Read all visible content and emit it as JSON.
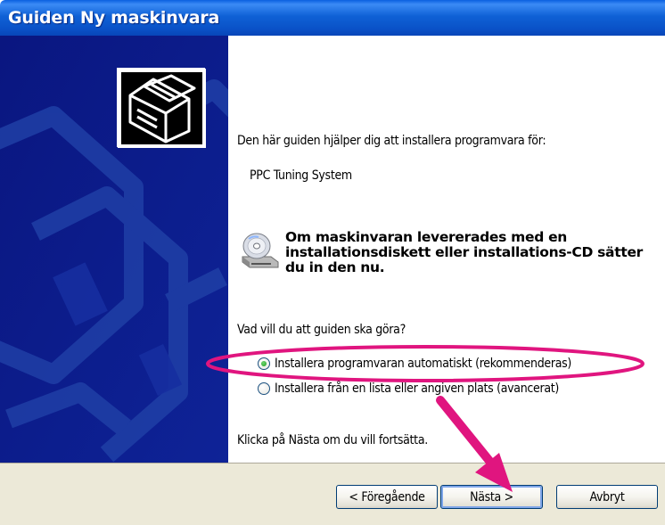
{
  "window": {
    "title": "Guiden Ny maskinvara"
  },
  "content": {
    "intro": "Den här guiden hjälper dig att installera programvara för:",
    "device_name": "PPC Tuning System",
    "cd_message": "Om maskinvaran levererades med en installationsdiskett eller installations-CD sätter du in den nu.",
    "question": "Vad vill du att guiden ska göra?",
    "options": [
      {
        "label": "Installera programvaran automatiskt (rekommenderas)",
        "selected": true
      },
      {
        "label": "Installera från en lista eller angiven plats (avancerat)",
        "selected": false
      }
    ],
    "footer": "Klicka på Nästa om du vill fortsätta."
  },
  "buttons": {
    "back": "< Föregående",
    "next": "Nästa >",
    "cancel": "Avbryt"
  },
  "icons": {
    "wizard": "hardware-wizard-icon",
    "cd": "cd-drive-icon"
  },
  "colors": {
    "title_bar": "#0a52c8",
    "side_panel": "#0b1a8e",
    "annotation": "#e0157f",
    "button_bar": "#ece9d8"
  }
}
